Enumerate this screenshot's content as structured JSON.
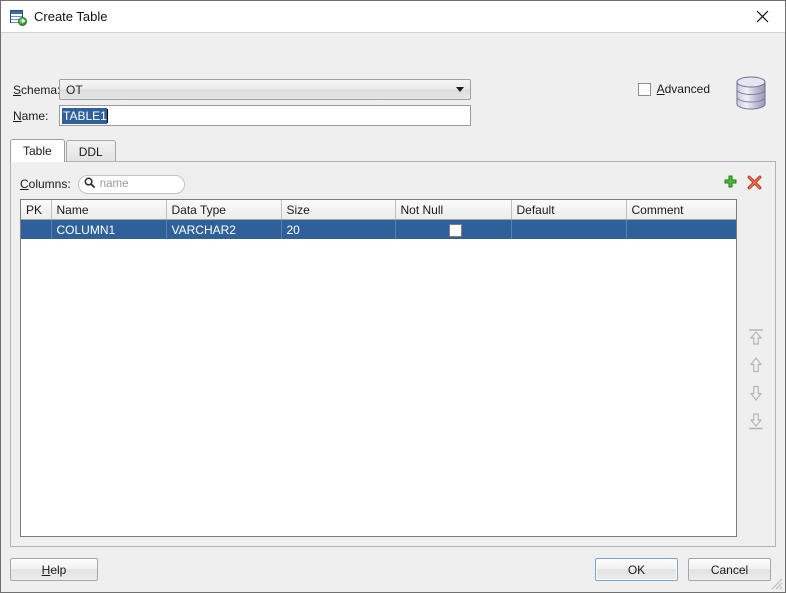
{
  "window": {
    "title": "Create Table",
    "icon": "create-table-icon",
    "close_icon": "close-icon"
  },
  "form": {
    "schema_label": "Schema:",
    "schema_label_mnemonic": "S",
    "schema_value": "OT",
    "name_label": "Name:",
    "name_label_mnemonic": "N",
    "name_value": "TABLE1",
    "advanced_label": "Advanced",
    "advanced_label_mnemonic": "A",
    "advanced_checked": false,
    "database_icon": "database-cylinder-icon"
  },
  "tabs": [
    {
      "label": "Table",
      "selected": true
    },
    {
      "label": "DDL",
      "selected": false
    }
  ],
  "columns_panel": {
    "columns_label": "Columns:",
    "columns_label_mnemonic": "C",
    "search_placeholder": "name",
    "search_value": "",
    "search_icon": "search-icon",
    "add_icon": "plus-icon",
    "remove_icon": "delete-x-icon",
    "reorder_buttons": [
      {
        "name": "move-to-top-button",
        "icon": "arrow-to-top-icon",
        "enabled": false
      },
      {
        "name": "move-up-button",
        "icon": "arrow-up-icon",
        "enabled": false
      },
      {
        "name": "move-down-button",
        "icon": "arrow-down-icon",
        "enabled": false
      },
      {
        "name": "move-to-bottom-button",
        "icon": "arrow-to-bottom-icon",
        "enabled": false
      }
    ]
  },
  "grid": {
    "headers": [
      "PK",
      "Name",
      "Data Type",
      "Size",
      "Not Null",
      "Default",
      "Comment"
    ],
    "rows": [
      {
        "selected": true,
        "pk": "",
        "name": "COLUMN1",
        "data_type": "VARCHAR2",
        "size": "20",
        "not_null_checked": false,
        "default": "",
        "comment": ""
      }
    ]
  },
  "footer": {
    "help_label": "Help",
    "help_mnemonic": "H",
    "ok_label": "OK",
    "cancel_label": "Cancel"
  },
  "colors": {
    "selection_blue": "#2f6099",
    "dialog_bg": "#efefef",
    "titlebar_bg": "#ffffff",
    "accent_green": "#3fa63f",
    "accent_red": "#d8412f"
  }
}
